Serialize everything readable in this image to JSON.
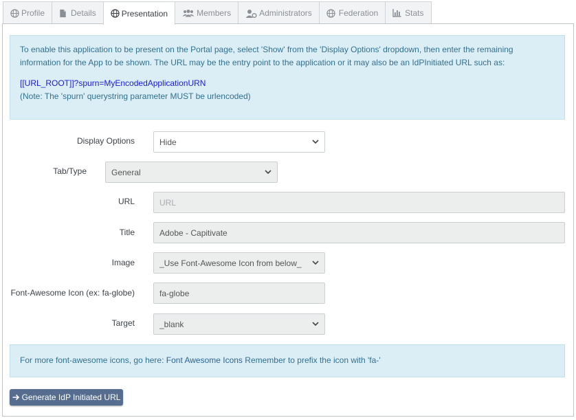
{
  "tabs": [
    {
      "label": "Profile",
      "icon": "globe-icon"
    },
    {
      "label": "Details",
      "icon": "file-icon"
    },
    {
      "label": "Presentation",
      "icon": "globe-icon",
      "active": true
    },
    {
      "label": "Members",
      "icon": "users-icon"
    },
    {
      "label": "Administrators",
      "icon": "user-cog-icon"
    },
    {
      "label": "Federation",
      "icon": "globe-icon"
    },
    {
      "label": "Stats",
      "icon": "bar-chart-icon"
    }
  ],
  "info_top": {
    "text": "To enable this application to be present on the Portal page, select 'Show' from the 'Display Options' dropdown, then enter the remaining information for the App to be shown. The URL may be the entry point to the application or it may also be an IdPInitiated URL such as:",
    "url_example": "[[URL_ROOT]]?spurn=MyEncodedApplicationURN",
    "note": "(Note: The 'spurn' querystring parameter MUST be urlencoded)"
  },
  "form": {
    "display_options": {
      "label": "Display Options",
      "value": "Hide"
    },
    "tab_type": {
      "label": "Tab/Type",
      "value": "General"
    },
    "url": {
      "label": "URL",
      "value": "",
      "placeholder": "URL"
    },
    "title": {
      "label": "Title",
      "value": "Adobe - Capitivate"
    },
    "image": {
      "label": "Image",
      "value": "_Use Font-Awesome Icon from below_"
    },
    "fa_icon": {
      "label": "Font-Awesome Icon (ex: fa-globe)",
      "value": "fa-globe"
    },
    "target": {
      "label": "Target",
      "value": "_blank"
    }
  },
  "info_bottom": {
    "prefix": "For more font-awesome icons, go here: ",
    "link_text": "Font Awesome Icons",
    "suffix": " Remember to prefix the icon with 'fa-'"
  },
  "generate_button": {
    "label": "Generate IdP Initiated URL",
    "icon": "arrow-right-icon"
  },
  "colors": {
    "info_bg": "#dbeef6",
    "info_text": "#31708f",
    "url_blue": "#1a1ad6",
    "button_bg": "#566d8f"
  }
}
